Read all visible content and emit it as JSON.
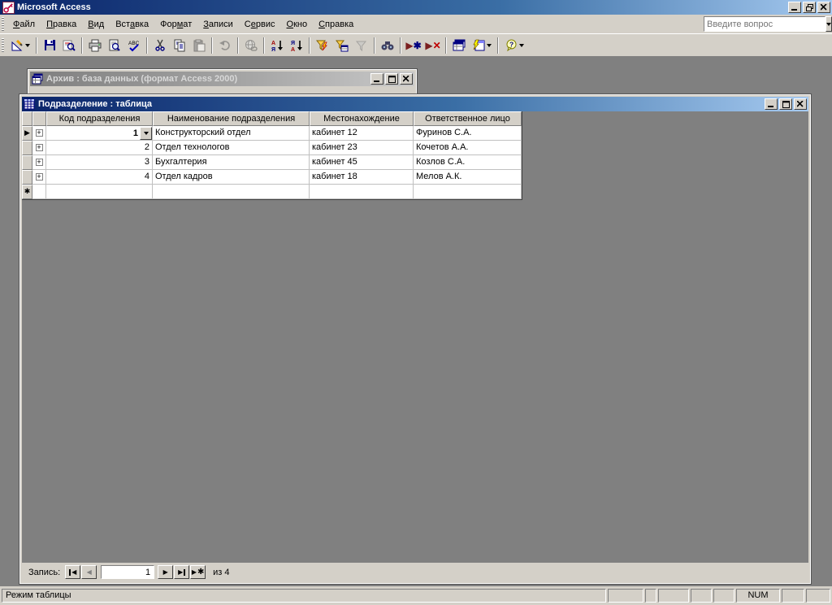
{
  "app": {
    "title": "Microsoft Access"
  },
  "menu": {
    "items": [
      {
        "name": "file",
        "label": "Файл",
        "u": 0
      },
      {
        "name": "edit",
        "label": "Правка",
        "u": 0
      },
      {
        "name": "view",
        "label": "Вид",
        "u": 0
      },
      {
        "name": "insert",
        "label": "Вставка",
        "u": 3
      },
      {
        "name": "format",
        "label": "Формат",
        "u": 3
      },
      {
        "name": "records",
        "label": "Записи",
        "u": 0
      },
      {
        "name": "tools",
        "label": "Сервис",
        "u": 1
      },
      {
        "name": "window",
        "label": "Окно",
        "u": 0
      },
      {
        "name": "help",
        "label": "Справка",
        "u": 0
      }
    ]
  },
  "ask_box": {
    "placeholder": "Введите вопрос"
  },
  "toolbar": {
    "buttons": [
      {
        "name": "view",
        "disabled": false,
        "dropdown": true
      },
      {
        "name": "save",
        "disabled": false
      },
      {
        "name": "file-search",
        "disabled": false
      },
      {
        "name": "print",
        "disabled": false
      },
      {
        "name": "print-preview",
        "disabled": false
      },
      {
        "name": "spelling",
        "disabled": false
      },
      {
        "name": "cut",
        "disabled": false
      },
      {
        "name": "copy",
        "disabled": false
      },
      {
        "name": "paste",
        "disabled": true
      },
      {
        "name": "undo",
        "disabled": true
      },
      {
        "name": "insert-hyperlink",
        "disabled": true
      },
      {
        "name": "sort-ascending",
        "disabled": false
      },
      {
        "name": "sort-descending",
        "disabled": false
      },
      {
        "name": "filter-by-selection",
        "disabled": false
      },
      {
        "name": "filter-by-form",
        "disabled": false
      },
      {
        "name": "apply-filter",
        "disabled": true
      },
      {
        "name": "find",
        "disabled": false
      },
      {
        "name": "new-record",
        "disabled": false
      },
      {
        "name": "delete-record",
        "disabled": false
      },
      {
        "name": "database-window",
        "disabled": false
      },
      {
        "name": "new-object",
        "disabled": false,
        "dropdown": true
      },
      {
        "name": "help",
        "disabled": false,
        "dropdown": true
      }
    ]
  },
  "db_window": {
    "title": "Архив : база данных (формат Access 2000)"
  },
  "table_window": {
    "title": "Подразделение : таблица",
    "columns": [
      "Код подразделения",
      "Наименование подразделения",
      "Местонахождение",
      "Ответственное лицо"
    ],
    "rows": [
      {
        "code": "1",
        "name": "Конструкторский отдел",
        "location": "кабинет 12",
        "person": "Фуринов С.А."
      },
      {
        "code": "2",
        "name": "Отдел технологов",
        "location": "кабинет 23",
        "person": "Кочетов А.А."
      },
      {
        "code": "3",
        "name": "Бухгалтерия",
        "location": "кабинет 45",
        "person": "Козлов С.А."
      },
      {
        "code": "4",
        "name": "Отдел кадров",
        "location": "кабинет 18",
        "person": "Мелов А.К."
      }
    ],
    "navigator": {
      "label": "Запись:",
      "current": "1",
      "of_label": "из 4"
    }
  },
  "status_bar": {
    "message": "Режим таблицы",
    "num_lock": "NUM"
  },
  "icons": {
    "expand": "+",
    "current_record_arrow": "▶",
    "new_row_star": "✱",
    "nav_first": "◀",
    "nav_prev": "◀",
    "nav_next": "▶",
    "nav_last": "▶",
    "nav_new": "▶",
    "nav_new_star": "✱"
  },
  "colors": {
    "title_active_start": "#0a246a",
    "title_active_end": "#a6caf0",
    "desktop": "#808080",
    "face": "#d4d0c8",
    "gridline": "#c0c0c0"
  }
}
